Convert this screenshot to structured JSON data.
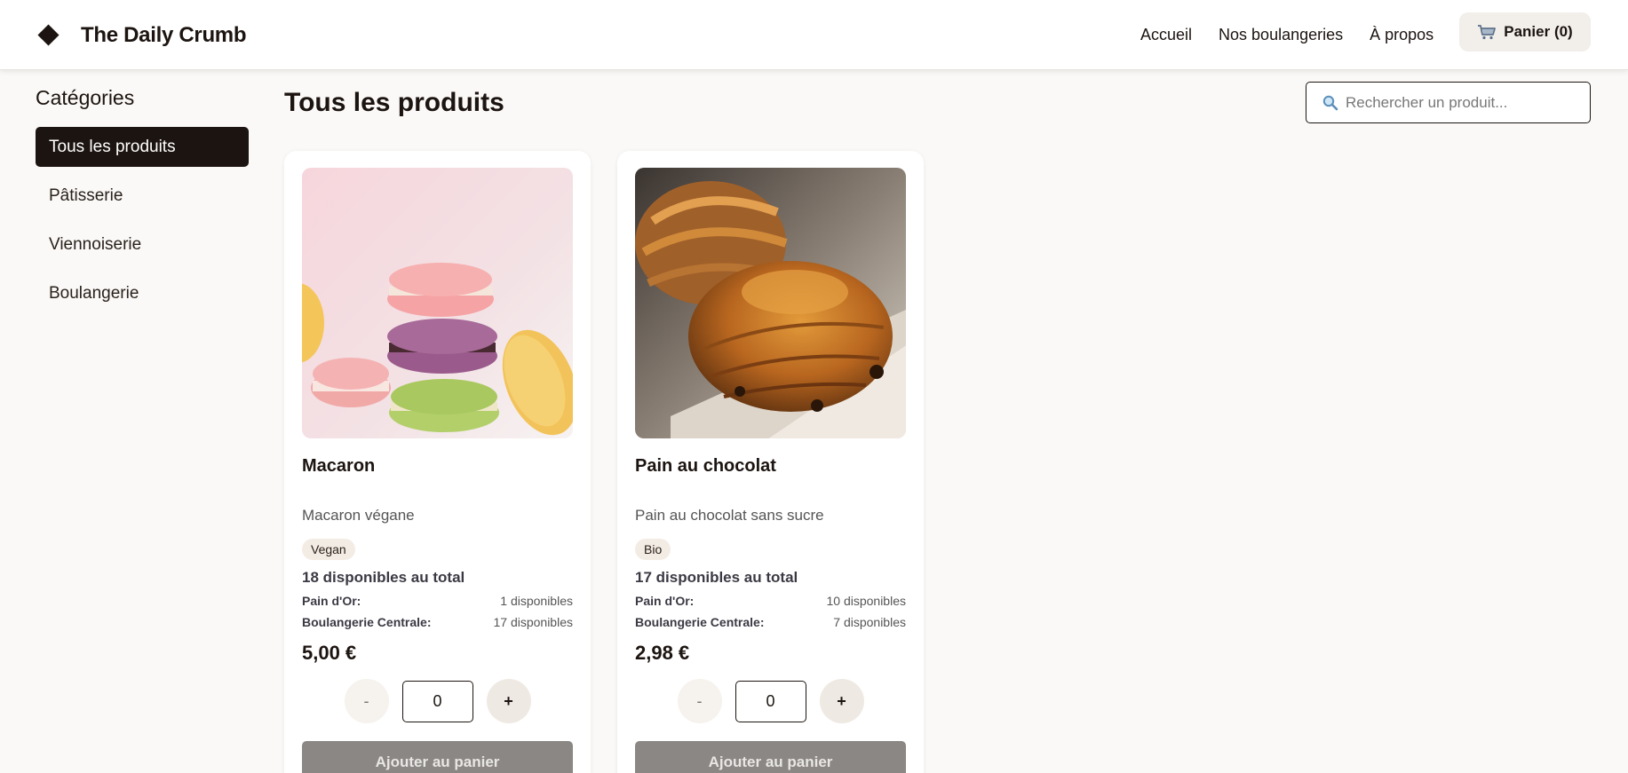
{
  "header": {
    "brand": "The Daily Crumb",
    "nav": [
      "Accueil",
      "Nos boulangeries",
      "À propos"
    ],
    "cart_label": "Panier (0)"
  },
  "sidebar": {
    "title": "Catégories",
    "items": [
      {
        "label": "Tous les produits",
        "active": true
      },
      {
        "label": "Pâtisserie",
        "active": false
      },
      {
        "label": "Viennoiserie",
        "active": false
      },
      {
        "label": "Boulangerie",
        "active": false
      }
    ]
  },
  "main": {
    "title": "Tous les produits",
    "search_placeholder": "Rechercher un produit..."
  },
  "products": [
    {
      "name": "Macaron",
      "description": "Macaron végane",
      "tag": "Vegan",
      "total": "18 disponibles au total",
      "stock": [
        {
          "store": "Pain d'Or:",
          "qty": "1 disponibles"
        },
        {
          "store": "Boulangerie Centrale:",
          "qty": "17 disponibles"
        }
      ],
      "price": "5,00 €",
      "quantity": "0",
      "minus": "-",
      "plus": "+",
      "add_label": "Ajouter au panier"
    },
    {
      "name": "Pain au chocolat",
      "description": "Pain au chocolat sans sucre",
      "tag": "Bio",
      "total": "17 disponibles au total",
      "stock": [
        {
          "store": "Pain d'Or:",
          "qty": "10 disponibles"
        },
        {
          "store": "Boulangerie Centrale:",
          "qty": "7 disponibles"
        }
      ],
      "price": "2,98 €",
      "quantity": "0",
      "minus": "-",
      "plus": "+",
      "add_label": "Ajouter au panier"
    }
  ],
  "colors": {
    "primary": "#1c1410",
    "background": "#faf9f7",
    "button_disabled": "#8a8784"
  }
}
